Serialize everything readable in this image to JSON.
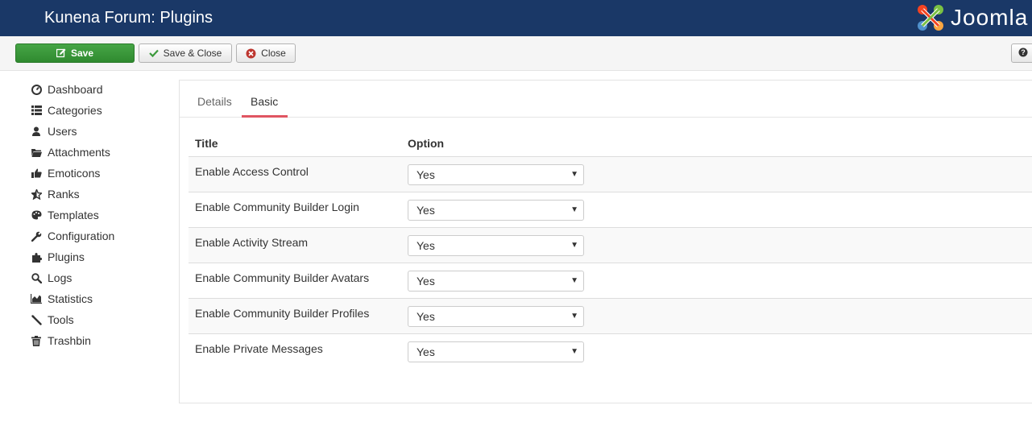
{
  "header": {
    "title": "Kunena Forum: Plugins",
    "logo_text": "Joomla",
    "bg_color": "#1a3867"
  },
  "toolbar": {
    "save_label": "Save",
    "save_close_label": "Save & Close",
    "close_label": "Close",
    "help_icon": "question-icon"
  },
  "sidebar": {
    "items": [
      {
        "label": "Dashboard",
        "icon": "dashboard-icon"
      },
      {
        "label": "Categories",
        "icon": "list-icon"
      },
      {
        "label": "Users",
        "icon": "user-icon"
      },
      {
        "label": "Attachments",
        "icon": "folder-icon"
      },
      {
        "label": "Emoticons",
        "icon": "thumbs-up-icon"
      },
      {
        "label": "Ranks",
        "icon": "star-icon"
      },
      {
        "label": "Templates",
        "icon": "palette-icon"
      },
      {
        "label": "Configuration",
        "icon": "wrench-icon"
      },
      {
        "label": "Plugins",
        "icon": "puzzle-icon"
      },
      {
        "label": "Logs",
        "icon": "search-icon"
      },
      {
        "label": "Statistics",
        "icon": "chart-icon"
      },
      {
        "label": "Tools",
        "icon": "tools-icon"
      },
      {
        "label": "Trashbin",
        "icon": "trash-icon"
      }
    ]
  },
  "tabs": [
    {
      "label": "Details",
      "active": false
    },
    {
      "label": "Basic",
      "active": true
    }
  ],
  "table": {
    "headers": {
      "title": "Title",
      "option": "Option"
    },
    "rows": [
      {
        "title": "Enable Access Control",
        "value": "Yes"
      },
      {
        "title": "Enable Community Builder Login",
        "value": "Yes"
      },
      {
        "title": "Enable Activity Stream",
        "value": "Yes"
      },
      {
        "title": "Enable Community Builder Avatars",
        "value": "Yes"
      },
      {
        "title": "Enable Community Builder Profiles",
        "value": "Yes"
      },
      {
        "title": "Enable Private Messages",
        "value": "Yes"
      }
    ]
  },
  "colors": {
    "save_button": "#3d9a3d",
    "tab_accent": "#e05561"
  }
}
